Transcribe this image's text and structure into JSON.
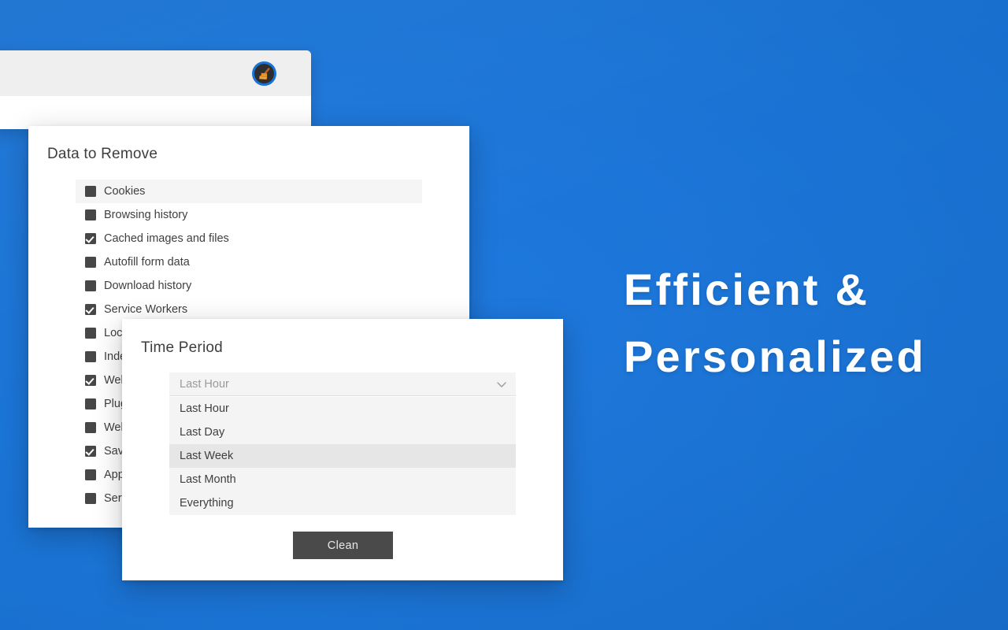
{
  "hero": {
    "line1": "Efficient &",
    "line2": "Personalized",
    "color": "#ffffff"
  },
  "theme": {
    "background_blue": "#1a73d4",
    "dialog_white": "#ffffff",
    "row_highlight": "#f5f5f5",
    "option_bg": "#f4f4f4",
    "option_selected": "#e6e6e6",
    "checkbox_fill": "#474747",
    "button_fill": "#4a4a4a",
    "text_dark": "#3f3f3f",
    "text_muted": "#9a9a9a"
  },
  "browser_window": {
    "toolbar_bg": "#efefef",
    "extension_icon": {
      "name": "broom-cleaner-icon",
      "ring_color": "#1a73d4",
      "disc_color": "#2e2e2e",
      "broom_color": "#e8932a",
      "handle_color": "#b5651d"
    }
  },
  "data_dialog": {
    "title": "Data to Remove",
    "items": [
      {
        "label": "Cookies",
        "checked": false,
        "highlighted": true
      },
      {
        "label": "Browsing history",
        "checked": false,
        "highlighted": false
      },
      {
        "label": "Cached images and files",
        "checked": true,
        "highlighted": false
      },
      {
        "label": "Autofill form data",
        "checked": false,
        "highlighted": false
      },
      {
        "label": "Download history",
        "checked": false,
        "highlighted": false
      },
      {
        "label": "Service Workers",
        "checked": true,
        "highlighted": false
      },
      {
        "label": "Local Storage",
        "checked": false,
        "highlighted": false
      },
      {
        "label": "IndexedDB",
        "checked": false,
        "highlighted": false
      },
      {
        "label": "WebSQL",
        "checked": true,
        "highlighted": false
      },
      {
        "label": "Plugin Data",
        "checked": false,
        "highlighted": false
      },
      {
        "label": "Web Storage",
        "checked": false,
        "highlighted": false
      },
      {
        "label": "Saved Passwords",
        "checked": true,
        "highlighted": false
      },
      {
        "label": "App Cache",
        "checked": false,
        "highlighted": false
      },
      {
        "label": "Server Bound Certificates",
        "checked": false,
        "highlighted": false
      }
    ]
  },
  "time_dialog": {
    "title": "Time Period",
    "select": {
      "value": "Last Hour",
      "chevron_icon": "chevron-down-icon",
      "options": [
        {
          "label": "Last Hour",
          "selected": false
        },
        {
          "label": "Last Day",
          "selected": false
        },
        {
          "label": "Last Week",
          "selected": true
        },
        {
          "label": "Last Month",
          "selected": false
        },
        {
          "label": "Everything",
          "selected": false
        }
      ]
    },
    "clean_button": "Clean"
  }
}
